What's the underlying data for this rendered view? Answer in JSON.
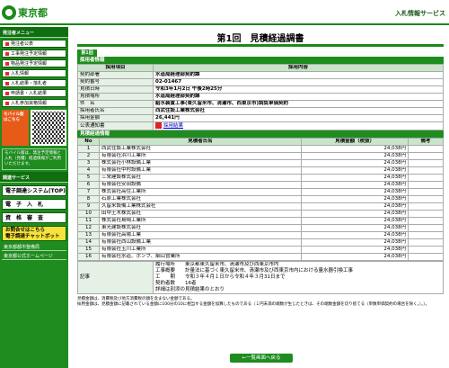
{
  "header": {
    "logo_text": "東京都",
    "service_title": "入札情報サービス"
  },
  "sidebar": {
    "menu_header": "発注者メニュー",
    "items": [
      {
        "label": "発注者公表"
      },
      {
        "label": "工事発注予定情報"
      },
      {
        "label": "物品発注予定情報"
      },
      {
        "label": "入札情報"
      },
      {
        "label": "入札結果・落札者"
      },
      {
        "label": "申請書・入札結果"
      },
      {
        "label": "入札参加資格情報"
      }
    ],
    "mobile_label": "モバイル版はこちら",
    "mobile_text": "モバイル版は、発注予定情報と入札（見積）経過情報がご利用いただけます。",
    "service_header": "関連サービス",
    "service_buttons": [
      {
        "label": "電子調達システム(TOP)"
      },
      {
        "label": "電　子　入　札"
      },
      {
        "label": "資　格　審　査"
      },
      {
        "label": "お問合せはこちら",
        "sub": "電子調達チャットボット"
      }
    ],
    "links": [
      {
        "label": "東京都都市整備局"
      },
      {
        "label": "東京都公式ホームページ"
      }
    ]
  },
  "main": {
    "page_title": "第1回　見積経過調書",
    "round_tab": "第1回",
    "section_adopter": "採用者情報",
    "adopter_cols": [
      "採用項目",
      "採用内容"
    ],
    "adopter_rows": [
      {
        "k": "契約部署",
        "v": "水道局経理部契約課"
      },
      {
        "k": "契約番号",
        "v": "02-01467"
      },
      {
        "k": "見積日時",
        "v": "令和3年1月2日 午後2時25分"
      },
      {
        "k": "見積場所",
        "v": "水道局経理部契約課"
      },
      {
        "k": "件　名",
        "v": "給水装置工事(東久留米市、清瀬市、西東京市)調負単価契約"
      },
      {
        "k": "採用者氏名",
        "v": "西武住設工業株式会社"
      },
      {
        "k": "採用金額",
        "v": "26,441円"
      },
      {
        "k": "公表通知書",
        "v": "採用結果"
      }
    ],
    "section_history": "見積経過情報",
    "history_cols": [
      "No",
      "見積者氏名",
      "見積金額（税抜）",
      "備考"
    ],
    "history_rows": [
      {
        "no": "1",
        "name": "西武住設工業株式会社",
        "amount": "24,038円"
      },
      {
        "no": "2",
        "name": "有限会社浜川工業所",
        "amount": "24,038円"
      },
      {
        "no": "3",
        "name": "株式会社小林設備工業",
        "amount": "24,038円"
      },
      {
        "no": "4",
        "name": "有限会社中村設備工業",
        "amount": "24,038円"
      },
      {
        "no": "5",
        "name": "三栄建設株式会社",
        "amount": "24,038円"
      },
      {
        "no": "6",
        "name": "有限会社安田設備",
        "amount": "24,038円"
      },
      {
        "no": "7",
        "name": "株式会社高住工業所",
        "amount": "24,038円"
      },
      {
        "no": "8",
        "name": "石原工業株式会社",
        "amount": "24,038円"
      },
      {
        "no": "9",
        "name": "久留米設備工業株式会社",
        "amount": "24,038円"
      },
      {
        "no": "10",
        "name": "田中土木株式会社",
        "amount": "24,038円"
      },
      {
        "no": "11",
        "name": "株式会社島崎工業所",
        "amount": "24,038円"
      },
      {
        "no": "12",
        "name": "東光建設株式会社",
        "amount": "24,038円"
      },
      {
        "no": "13",
        "name": "有限会社高陽工業",
        "amount": "24,038円"
      },
      {
        "no": "14",
        "name": "有限会社西山設備工業",
        "amount": "24,038円"
      },
      {
        "no": "15",
        "name": "有限会社玉川工業所",
        "amount": "24,038円"
      },
      {
        "no": "16",
        "name": "有限会社水道、ポンプ、細山営業所",
        "amount": "24,038円"
      }
    ],
    "remarks_label": "記事",
    "remarks_lines": [
      "履行場所　　東京都東久留米市、清瀬市及び西東京市内",
      "工事概要　　計量法に基づく東久留米市、清瀬市及び西東京市内における量水器引換工事",
      "工　　期　　令和３年４月１日から令和４年３月31日まで",
      "契約者数　　16者",
      "詳細は別添の見積結果のとおり"
    ],
    "notes": [
      "見積金額は、消費税及び地方消費税の額を含まない金額である。",
      "採用金額は、見積金額に記載されている金額に100分の10に相当する金額を加算したものである（１円未満の端数が生じたときは、その端数金額を切り捨てる（単数単価契約の場合を除く。）。）。"
    ],
    "back_button": "←一覧画面へ戻る"
  }
}
